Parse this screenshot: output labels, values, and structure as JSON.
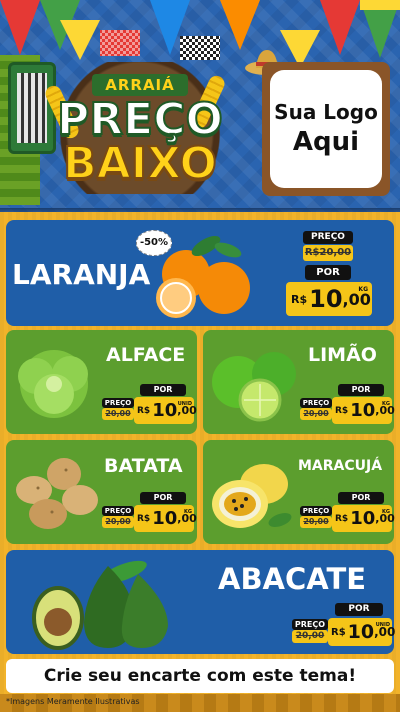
{
  "header": {
    "arraia": "ARRAIÁ",
    "preco": "PREÇO",
    "baixo": "BAIXO",
    "logo_line1": "Sua Logo",
    "logo_line2": "Aqui"
  },
  "products": {
    "laranja": {
      "name": "LARANJA",
      "discount": "-50%",
      "old_label": "PREÇO",
      "old_price": "R$20,00",
      "por_label": "POR",
      "rs": "R$",
      "int": "10",
      "dec": ",00",
      "unit": "KG"
    },
    "alface": {
      "name": "ALFACE",
      "old_label": "PREÇO",
      "old_price": "20,00",
      "por_label": "POR",
      "rs": "R$",
      "int": "10",
      "dec": ",00",
      "unit": "UNID"
    },
    "limao": {
      "name": "LIMÃO",
      "old_label": "PREÇO",
      "old_price": "20,00",
      "por_label": "POR",
      "rs": "R$",
      "int": "10",
      "dec": ",00",
      "unit": "KG"
    },
    "batata": {
      "name": "BATATA",
      "old_label": "PREÇO",
      "old_price": "20,00",
      "por_label": "POR",
      "rs": "R$",
      "int": "10",
      "dec": ",00",
      "unit": "KG"
    },
    "maracuja": {
      "name": "MARACUJÁ",
      "old_label": "PREÇO",
      "old_price": "20,00",
      "por_label": "POR",
      "rs": "R$",
      "int": "10",
      "dec": ",00",
      "unit": "KG"
    },
    "abacate": {
      "name": "ABACATE",
      "old_label": "PREÇO",
      "old_price": "20,00",
      "por_label": "POR",
      "rs": "R$",
      "int": "10",
      "dec": ",00",
      "unit": "UNID"
    }
  },
  "footer": {
    "cta": "Crie seu encarte com este tema!",
    "disclaimer": "*Imagens Meramente Ilustrativas"
  },
  "colors": {
    "header_blue": "#2a64b0",
    "card_blue": "#1f5ea8",
    "card_green": "#5c9e2e",
    "price_yellow": "#f5c518",
    "background_orange": "#f2b32a"
  },
  "icons": [
    "bunting-flags",
    "accordion-icon",
    "corn-icon",
    "straw-hat-icon",
    "orange-fruit",
    "lettuce",
    "lime",
    "potato",
    "passion-fruit",
    "avocado"
  ]
}
